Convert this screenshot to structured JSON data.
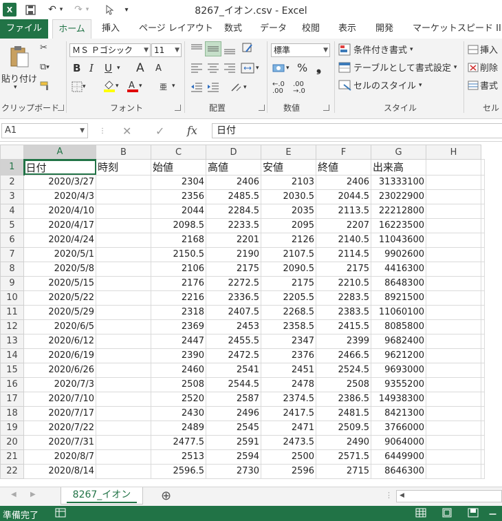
{
  "window": {
    "title": "8267_イオン.csv - Excel"
  },
  "quick_access": {
    "logo": "X",
    "save_icon": "💾",
    "undo_icon": "↶",
    "redo_icon": "↷",
    "customize_icon": "▾"
  },
  "tabs": [
    {
      "label": "ファイル"
    },
    {
      "label": "ホーム"
    },
    {
      "label": "挿入"
    },
    {
      "label": "ページ レイアウト"
    },
    {
      "label": "数式"
    },
    {
      "label": "データ"
    },
    {
      "label": "校閲"
    },
    {
      "label": "表示"
    },
    {
      "label": "開発"
    },
    {
      "label": "マーケットスピード II"
    }
  ],
  "ribbon": {
    "clipboard": {
      "paste_label": "貼り付け",
      "group_label": "クリップボード"
    },
    "font": {
      "font_name": "ＭＳ Ｐゴシック",
      "font_size": "11",
      "bold": "B",
      "italic": "I",
      "underline": "U",
      "grow": "A",
      "shrink": "A",
      "phonetic": "亜",
      "group_label": "フォント"
    },
    "alignment": {
      "group_label": "配置"
    },
    "number": {
      "format": "標準",
      "percent": "%",
      "comma": "❟",
      "inc_decimal": "←.0 .00",
      "dec_decimal": ".00 →.0",
      "group_label": "数値"
    },
    "styles": {
      "conditional": "条件付き書式",
      "as_table": "テーブルとして書式設定",
      "cell_styles": "セルのスタイル",
      "group_label": "スタイル"
    },
    "cells": {
      "insert": "挿入",
      "delete": "削除",
      "format": "書式",
      "group_label": "セル"
    }
  },
  "formula_bar": {
    "name_box": "A1",
    "cancel_icon": "✕",
    "enter_icon": "✓",
    "fx_label": "fx",
    "formula": "日付"
  },
  "grid": {
    "columns": [
      "A",
      "B",
      "C",
      "D",
      "E",
      "F",
      "G",
      "H"
    ],
    "header_row": [
      "日付",
      "時刻",
      "始値",
      "高値",
      "安値",
      "終値",
      "出来高",
      ""
    ],
    "rows": [
      {
        "n": "2",
        "cells": [
          "2020/3/27",
          "",
          "2304",
          "2406",
          "2103",
          "2406",
          "31333100",
          ""
        ]
      },
      {
        "n": "3",
        "cells": [
          "2020/4/3",
          "",
          "2356",
          "2485.5",
          "2030.5",
          "2044.5",
          "23022900",
          ""
        ]
      },
      {
        "n": "4",
        "cells": [
          "2020/4/10",
          "",
          "2044",
          "2284.5",
          "2035",
          "2113.5",
          "22212800",
          ""
        ]
      },
      {
        "n": "5",
        "cells": [
          "2020/4/17",
          "",
          "2098.5",
          "2233.5",
          "2095",
          "2207",
          "16223500",
          ""
        ]
      },
      {
        "n": "6",
        "cells": [
          "2020/4/24",
          "",
          "2168",
          "2201",
          "2126",
          "2140.5",
          "11043600",
          ""
        ]
      },
      {
        "n": "7",
        "cells": [
          "2020/5/1",
          "",
          "2150.5",
          "2190",
          "2107.5",
          "2114.5",
          "9902600",
          ""
        ]
      },
      {
        "n": "8",
        "cells": [
          "2020/5/8",
          "",
          "2106",
          "2175",
          "2090.5",
          "2175",
          "4416300",
          ""
        ]
      },
      {
        "n": "9",
        "cells": [
          "2020/5/15",
          "",
          "2176",
          "2272.5",
          "2175",
          "2210.5",
          "8648300",
          ""
        ]
      },
      {
        "n": "10",
        "cells": [
          "2020/5/22",
          "",
          "2216",
          "2336.5",
          "2205.5",
          "2283.5",
          "8921500",
          ""
        ]
      },
      {
        "n": "11",
        "cells": [
          "2020/5/29",
          "",
          "2318",
          "2407.5",
          "2268.5",
          "2383.5",
          "11060100",
          ""
        ]
      },
      {
        "n": "12",
        "cells": [
          "2020/6/5",
          "",
          "2369",
          "2453",
          "2358.5",
          "2415.5",
          "8085800",
          ""
        ]
      },
      {
        "n": "13",
        "cells": [
          "2020/6/12",
          "",
          "2447",
          "2455.5",
          "2347",
          "2399",
          "9682400",
          ""
        ]
      },
      {
        "n": "14",
        "cells": [
          "2020/6/19",
          "",
          "2390",
          "2472.5",
          "2376",
          "2466.5",
          "9621200",
          ""
        ]
      },
      {
        "n": "15",
        "cells": [
          "2020/6/26",
          "",
          "2460",
          "2541",
          "2451",
          "2524.5",
          "9693000",
          ""
        ]
      },
      {
        "n": "16",
        "cells": [
          "2020/7/3",
          "",
          "2508",
          "2544.5",
          "2478",
          "2508",
          "9355200",
          ""
        ]
      },
      {
        "n": "17",
        "cells": [
          "2020/7/10",
          "",
          "2520",
          "2587",
          "2374.5",
          "2386.5",
          "14938300",
          ""
        ]
      },
      {
        "n": "18",
        "cells": [
          "2020/7/17",
          "",
          "2430",
          "2496",
          "2417.5",
          "2481.5",
          "8421300",
          ""
        ]
      },
      {
        "n": "19",
        "cells": [
          "2020/7/22",
          "",
          "2489",
          "2545",
          "2471",
          "2509.5",
          "3766000",
          ""
        ]
      },
      {
        "n": "20",
        "cells": [
          "2020/7/31",
          "",
          "2477.5",
          "2591",
          "2473.5",
          "2490",
          "9064000",
          ""
        ]
      },
      {
        "n": "21",
        "cells": [
          "2020/8/7",
          "",
          "2513",
          "2594",
          "2500",
          "2571.5",
          "6449900",
          ""
        ]
      },
      {
        "n": "22",
        "cells": [
          "2020/8/14",
          "",
          "2596.5",
          "2730",
          "2596",
          "2715",
          "8646300",
          ""
        ]
      }
    ]
  },
  "sheet_tabs": {
    "active": "8267_イオン",
    "add_icon": "⊕"
  },
  "status": {
    "ready": "準備完了",
    "zoom_minus": "－"
  }
}
